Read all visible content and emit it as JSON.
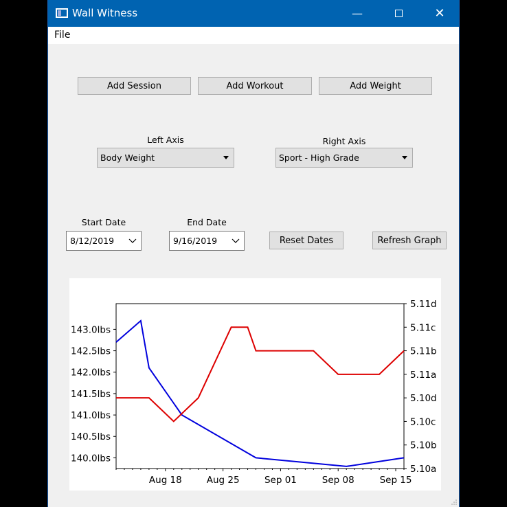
{
  "window": {
    "title": "Wall Witness"
  },
  "menu": {
    "file": "File"
  },
  "buttons": {
    "add_session": "Add Session",
    "add_workout": "Add Workout",
    "add_weight": "Add Weight",
    "reset_dates": "Reset Dates",
    "refresh_graph": "Refresh Graph"
  },
  "axes": {
    "left_label": "Left Axis",
    "left_value": "Body Weight",
    "right_label": "Right Axis",
    "right_value": "Sport - High Grade"
  },
  "dates": {
    "start_label": "Start Date",
    "start_value": "8/12/2019",
    "end_label": "End Date",
    "end_value": "9/16/2019"
  },
  "chart_data": {
    "type": "line",
    "x_labels": [
      "Aug 18",
      "Aug 25",
      "Sep 01",
      "Sep 08",
      "Sep 15"
    ],
    "y_left_ticks": [
      "140.0lbs",
      "140.5lbs",
      "141.0lbs",
      "141.5lbs",
      "142.0lbs",
      "142.5lbs",
      "143.0lbs"
    ],
    "y_right_ticks": [
      "5.10a",
      "5.10b",
      "5.10c",
      "5.10d",
      "5.11a",
      "5.11b",
      "5.11c",
      "5.11d"
    ],
    "series": [
      {
        "axis": "left",
        "color": "#0000dd",
        "points": [
          [
            "2019-08-12",
            142.7
          ],
          [
            "2019-08-15",
            143.2
          ],
          [
            "2019-08-16",
            142.1
          ],
          [
            "2019-08-20",
            141.0
          ],
          [
            "2019-08-29",
            140.0
          ],
          [
            "2019-09-09",
            139.8
          ],
          [
            "2019-09-16",
            140.0
          ]
        ]
      },
      {
        "axis": "right",
        "color": "#dd0000",
        "points": [
          [
            "2019-08-12",
            3
          ],
          [
            "2019-08-16",
            3
          ],
          [
            "2019-08-19",
            2
          ],
          [
            "2019-08-22",
            3
          ],
          [
            "2019-08-26",
            6
          ],
          [
            "2019-08-28",
            6
          ],
          [
            "2019-08-29",
            5
          ],
          [
            "2019-09-05",
            5
          ],
          [
            "2019-09-08",
            4
          ],
          [
            "2019-09-13",
            4
          ],
          [
            "2019-09-16",
            5
          ]
        ]
      }
    ]
  }
}
